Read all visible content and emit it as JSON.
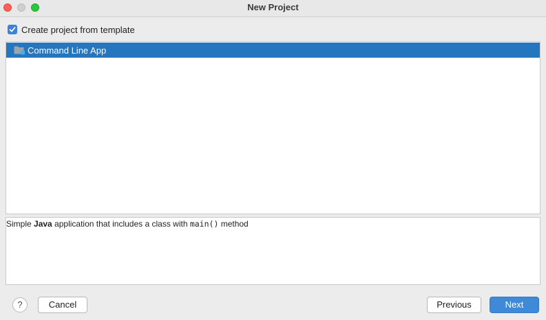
{
  "window": {
    "title": "New Project"
  },
  "template_checkbox": {
    "label": "Create project from template",
    "checked": true
  },
  "templates": {
    "items": [
      {
        "label": "Command Line App",
        "icon": "folder-icon",
        "selected": true
      }
    ]
  },
  "description": {
    "prefix": "Simple ",
    "bold": "Java",
    "middle": " application that includes a class with ",
    "code": "main()",
    "suffix": " method"
  },
  "footer": {
    "help_label": "?",
    "cancel_label": "Cancel",
    "previous_label": "Previous",
    "next_label": "Next"
  },
  "colors": {
    "selection": "#2675bf",
    "primary_button": "#3f8ad8",
    "checkbox": "#3d82d6"
  }
}
